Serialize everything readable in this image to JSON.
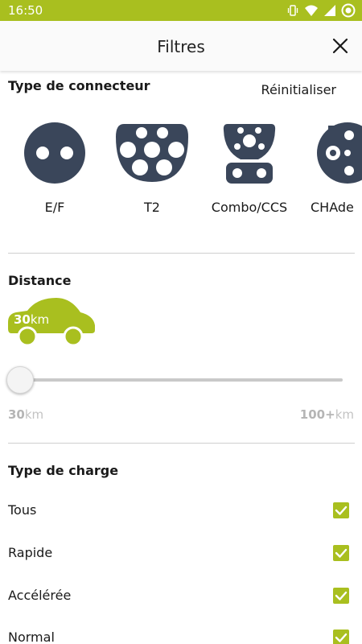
{
  "status_bar": {
    "time": "16:50",
    "icons": [
      "vibrate-icon",
      "wifi-icon",
      "signal-icon",
      "sync-icon"
    ],
    "background_color": "#a9bf1f"
  },
  "header": {
    "title": "Filtres",
    "close_icon": "close-icon"
  },
  "connector_section": {
    "title": "Type de connecteur",
    "reset_label": "Réinitialiser",
    "connectors": [
      {
        "label": "E/F",
        "icon": "ef-plug-icon"
      },
      {
        "label": "T2",
        "icon": "t2-plug-icon"
      },
      {
        "label": "Combo/CCS",
        "icon": "combo-ccs-plug-icon"
      },
      {
        "label": "CHAde",
        "icon": "chademo-plug-icon"
      }
    ],
    "icon_color": "#3a465a"
  },
  "distance_section": {
    "title": "Distance",
    "car_value": "30",
    "car_unit": "km",
    "slider_value": 0,
    "min_value": "30",
    "min_unit": "km",
    "max_value": "100+",
    "max_unit": "km",
    "accent_color": "#a9bf1f"
  },
  "charge_section": {
    "title": "Type de charge",
    "options": [
      {
        "label": "Tous",
        "checked": true
      },
      {
        "label": "Rapide",
        "checked": true
      },
      {
        "label": "Accélérée",
        "checked": true
      },
      {
        "label": "Normal",
        "checked": true
      }
    ]
  }
}
